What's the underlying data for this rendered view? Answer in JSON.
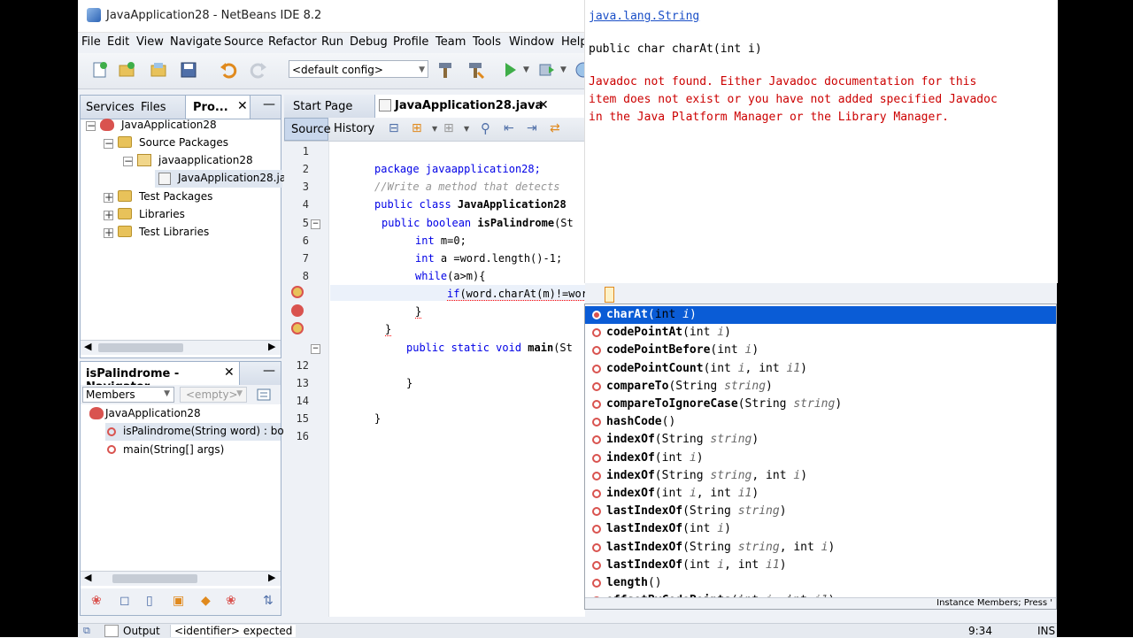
{
  "window": {
    "title": "JavaApplication28 - NetBeans IDE 8.2"
  },
  "menu": [
    "File",
    "Edit",
    "View",
    "Navigate",
    "Source",
    "Refactor",
    "Run",
    "Debug",
    "Profile",
    "Team",
    "Tools",
    "Window",
    "Help"
  ],
  "toolbar": {
    "config": "<default config>"
  },
  "projects_panel": {
    "tabs": [
      "Services",
      "Files",
      "Pro..."
    ],
    "tree": [
      {
        "label": "JavaApplication28"
      },
      {
        "label": "Source Packages"
      },
      {
        "label": "javaapplication28"
      },
      {
        "label": "JavaApplication28.ja"
      },
      {
        "label": "Test Packages"
      },
      {
        "label": "Libraries"
      },
      {
        "label": "Test Libraries"
      }
    ]
  },
  "navigator": {
    "title": "isPalindrome - Navigator",
    "filter": "Members",
    "empty": "<empty>",
    "items": [
      {
        "label": "JavaApplication28"
      },
      {
        "label": "isPalindrome(String word) : boole"
      },
      {
        "label": "main(String[] args)"
      }
    ]
  },
  "editor": {
    "tabs": [
      "Start Page",
      "JavaApplication28.java"
    ],
    "subtabs": [
      "Source",
      "History"
    ],
    "line_numbers": [
      "1",
      "2",
      "3",
      "4",
      "5",
      "6",
      "7",
      "8",
      "9",
      "10",
      "11",
      "12",
      "13",
      "14",
      "15",
      "16"
    ],
    "lines": {
      "l2": "package javaapplication28;",
      "l3": "//Write a method that detects",
      "l4_kw": "public class ",
      "l4_name": "JavaApplication28",
      "l5_kw": "public boolean ",
      "l5_name": "isPalindrome",
      "l5_rest": "(St",
      "l6_kw": "int ",
      "l6_rest": "m=0;",
      "l7_kw": "int ",
      "l7_rest": "a =word.length()-1;",
      "l8_kw": "while",
      "l8_rest": "(a>m){",
      "l9_kw": "if",
      "l9_rest": "(word.charAt(m)!=word.",
      "l10": "}",
      "l11": "}",
      "l12_kw": "public static void ",
      "l12_name": "main",
      "l12_rest": "(St",
      "l13": "",
      "l14": "}",
      "l16": "}"
    }
  },
  "javadoc": {
    "link": "java.lang.String",
    "signature": "public char charAt(int i)",
    "message1": "Javadoc not found. Either Javadoc documentation for this",
    "message2": "item does not exist or you have not added specified Javadoc",
    "message3": "in the Java Platform Manager or the Library Manager."
  },
  "completion": [
    {
      "name": "charAt",
      "open": "(",
      "t1": "int ",
      "p1": "i",
      "rest": ")"
    },
    {
      "name": "codePointAt",
      "open": "(",
      "t1": "int ",
      "p1": "i",
      "rest": ")"
    },
    {
      "name": "codePointBefore",
      "open": "(",
      "t1": "int ",
      "p1": "i",
      "rest": ")"
    },
    {
      "name": "codePointCount",
      "open": "(",
      "t1": "int ",
      "p1": "i",
      "sep": ", ",
      "t2": "int ",
      "p2": "i1",
      "rest": ")"
    },
    {
      "name": "compareTo",
      "open": "(",
      "t1": "String ",
      "p1": "string",
      "rest": ")"
    },
    {
      "name": "compareToIgnoreCase",
      "open": "(",
      "t1": "String ",
      "p1": "string",
      "rest": ")"
    },
    {
      "name": "hashCode",
      "open": "()",
      "rest": ""
    },
    {
      "name": "indexOf",
      "open": "(",
      "t1": "String ",
      "p1": "string",
      "rest": ")"
    },
    {
      "name": "indexOf",
      "open": "(",
      "t1": "int ",
      "p1": "i",
      "rest": ")"
    },
    {
      "name": "indexOf",
      "open": "(",
      "t1": "String ",
      "p1": "string",
      "sep": ", ",
      "t2": "int ",
      "p2": "i",
      "rest": ")"
    },
    {
      "name": "indexOf",
      "open": "(",
      "t1": "int ",
      "p1": "i",
      "sep": ", ",
      "t2": "int ",
      "p2": "i1",
      "rest": ")"
    },
    {
      "name": "lastIndexOf",
      "open": "(",
      "t1": "String ",
      "p1": "string",
      "rest": ")"
    },
    {
      "name": "lastIndexOf",
      "open": "(",
      "t1": "int ",
      "p1": "i",
      "rest": ")"
    },
    {
      "name": "lastIndexOf",
      "open": "(",
      "t1": "String ",
      "p1": "string",
      "sep": ", ",
      "t2": "int ",
      "p2": "i",
      "rest": ")"
    },
    {
      "name": "lastIndexOf",
      "open": "(",
      "t1": "int ",
      "p1": "i",
      "sep": ", ",
      "t2": "int ",
      "p2": "i1",
      "rest": ")"
    },
    {
      "name": "length",
      "open": "()",
      "rest": ""
    },
    {
      "name": "offsetByCodePoints",
      "open": "(",
      "t1": "int ",
      "p1": "i",
      "sep": ", ",
      "t2": "int ",
      "p2": "i1",
      "rest": ")"
    }
  ],
  "completion_footer": "Instance Members; Press '",
  "status": {
    "output": "Output",
    "message": "<identifier> expected",
    "position": "9:34",
    "mode": "INS"
  }
}
